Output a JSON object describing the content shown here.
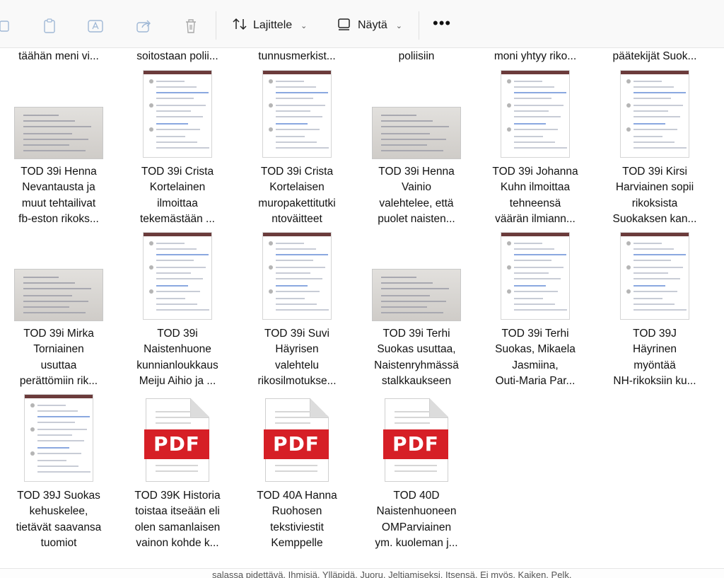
{
  "toolbar": {
    "sort_label": "Lajittele",
    "view_label": "Näytä",
    "more_label": "•••"
  },
  "top_row": [
    "täähän meni vi...",
    "soitostaan polii...",
    "tunnusmerkist...",
    "poliisiin",
    "moni yhtyy riko...",
    "päätekijät Suok..."
  ],
  "files": [
    {
      "name": "TOD 39i  Henna\nNevantausta  ja\nmuut tehtailivat\nfb-eston rikoks...",
      "thumb": "landscape"
    },
    {
      "name": "TOD 39i Crista\nKortelainen\nilmoittaa\ntekemästään ...",
      "thumb": "portrait"
    },
    {
      "name": "TOD 39i Crista\nKortelaisen\nmuropakettitutki\nntoväitteet",
      "thumb": "portrait"
    },
    {
      "name": "TOD 39i Henna\nVainio\nvalehtelee, että\npuolet naisten...",
      "thumb": "landscape"
    },
    {
      "name": "TOD 39i Johanna\nKuhn ilmoittaa\ntehneensä\nväärän ilmiann...",
      "thumb": "portrait"
    },
    {
      "name": "TOD 39i Kirsi\nHarviainen sopii\nrikoksista\nSuokaksen kan...",
      "thumb": "portrait"
    },
    {
      "name": "TOD 39i Mirka\nTorniainen\nusuttaa\nperättömiin rik...",
      "thumb": "landscape"
    },
    {
      "name": "TOD 39i\nNaistenhuone\nkunnianloukkaus\nMeiju Aihio ja ...",
      "thumb": "portrait"
    },
    {
      "name": "TOD 39i Suvi\nHäyrisen\nvalehtelu\nrikosilmotukse...",
      "thumb": "portrait"
    },
    {
      "name": "TOD 39i Terhi\nSuokas usuttaa,\nNaistenryhmässä\nstalkkaukseen",
      "thumb": "landscape"
    },
    {
      "name": "TOD 39i Terhi\nSuokas, Mikaela\nJasmiina,\nOuti-Maria Par...",
      "thumb": "portrait"
    },
    {
      "name": "TOD 39J\nHäyrinen\nmyöntää\nNH-rikoksiin ku...",
      "thumb": "portrait"
    },
    {
      "name": "TOD 39J Suokas\nkehuskelee,\ntietävät saavansa\ntuomiot",
      "thumb": "portrait"
    },
    {
      "name": "TOD 39K Historia\ntoistaa itseään eli\nolen samanlaisen\nvainon kohde k...",
      "thumb": "pdf"
    },
    {
      "name": "TOD 40A Hanna\nRuohosen\ntekstiviestit\nKemppelle",
      "thumb": "pdf"
    },
    {
      "name": "TOD 40D\nNaistenhuoneen\nOMParviainen\nym. kuoleman j...",
      "thumb": "pdf"
    }
  ],
  "pdf_label": "PDF",
  "status_strip_text": "salassa pidettävä. Ihmisiä. Ylläpidä. Juoru. Jeltiamiseksi. Itsensä. Ei myös. Kaiken. Pelk.",
  "colors": {
    "pdf_red": "#d61f26",
    "toolbar_bg": "#f9f9f9"
  }
}
